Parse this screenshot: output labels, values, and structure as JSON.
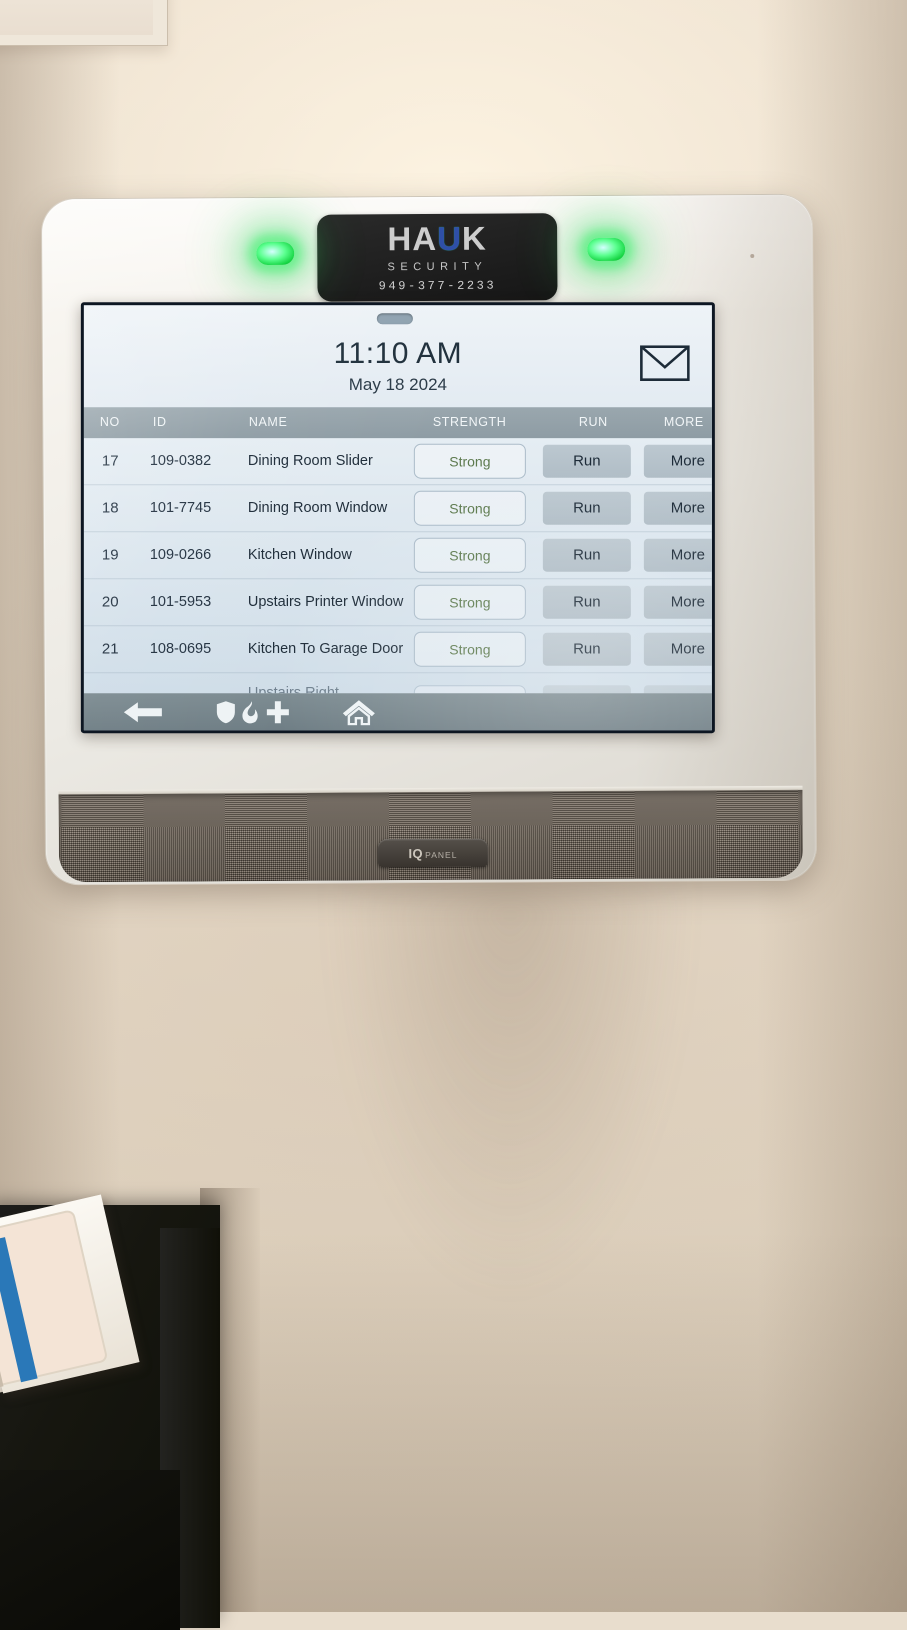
{
  "scene": {
    "description": "Wall-mounted Qolsys IQ Panel security touchscreen showing sensor list"
  },
  "device": {
    "brand_plate": {
      "name_prefix": "HA",
      "name_u": "U",
      "name_suffix": "K",
      "name_full": "HAUK",
      "subtitle": "SECURITY",
      "phone": "949-377-2233"
    },
    "bottom_badge": {
      "iq": "IQ",
      "panel": "PANEL"
    },
    "led_color": "#3ce06e"
  },
  "screen": {
    "header": {
      "time": "11:10 AM",
      "date": "May 18 2024",
      "mail_icon": "envelope-icon"
    },
    "table": {
      "columns": [
        "NO",
        "ID",
        "NAME",
        "STRENGTH",
        "RUN",
        "MORE"
      ],
      "rows": [
        {
          "no": "17",
          "id": "109-0382",
          "name": "Dining Room Slider",
          "strength": "Strong",
          "run": "Run",
          "more": "More"
        },
        {
          "no": "18",
          "id": "101-7745",
          "name": "Dining Room Window",
          "strength": "Strong",
          "run": "Run",
          "more": "More"
        },
        {
          "no": "19",
          "id": "109-0266",
          "name": "Kitchen Window",
          "strength": "Strong",
          "run": "Run",
          "more": "More"
        },
        {
          "no": "20",
          "id": "101-5953",
          "name": "Upstairs Printer Window",
          "strength": "Strong",
          "run": "Run",
          "more": "More"
        },
        {
          "no": "21",
          "id": "108-0695",
          "name": "Kitchen To Garage Door",
          "strength": "Strong",
          "run": "Run",
          "more": "More"
        }
      ],
      "partial_row": {
        "no": "",
        "id": "",
        "name": "Upstairs Right",
        "strength": "",
        "run": "",
        "more": ""
      },
      "strength_color": "#5d7a4e"
    },
    "navbar": {
      "items": [
        {
          "icon": "back-arrow-icon",
          "label": "Back"
        },
        {
          "icon": "shield-icon",
          "label": "Police"
        },
        {
          "icon": "fire-icon",
          "label": "Fire"
        },
        {
          "icon": "medical-cross-icon",
          "label": "Medical"
        },
        {
          "icon": "home-icon",
          "label": "Home"
        }
      ]
    }
  }
}
